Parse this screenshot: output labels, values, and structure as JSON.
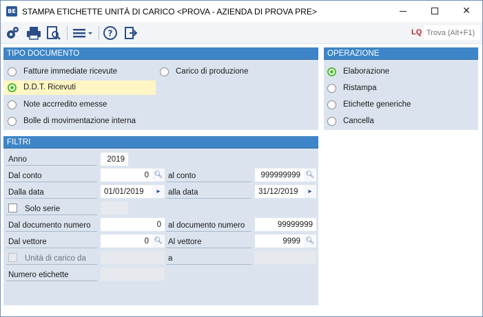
{
  "window": {
    "title": "STAMPA ETICHETTE UNITÀ DI CARICO <PROVA - AZIENDA DI PROVA PRE>",
    "app_icon": "BE"
  },
  "toolbar": {
    "search_prefix": "LQ",
    "search_placeholder": "Trova (Alt+F1)",
    "icons": [
      "settings-icon",
      "print-icon",
      "print-preview-icon",
      "menu-icon",
      "help-icon",
      "exit-icon"
    ]
  },
  "tipo_documento": {
    "header": "TIPO DOCUMENTO",
    "options": [
      {
        "label": "Fatture immediate ricevute",
        "selected": false
      },
      {
        "label": "Carico di produzione",
        "selected": false
      },
      {
        "label": "D.D.T. Ricevuti",
        "selected": true
      },
      {
        "label": "Note accrredito emesse",
        "selected": false
      },
      {
        "label": "Bolle di movimentazione interna",
        "selected": false
      }
    ]
  },
  "operazione": {
    "header": "OPERAZIONE",
    "options": [
      {
        "label": "Elaborazione",
        "selected": true
      },
      {
        "label": "Ristampa",
        "selected": false
      },
      {
        "label": "Etichette generiche",
        "selected": false
      },
      {
        "label": "Cancella",
        "selected": false
      }
    ]
  },
  "filtri": {
    "header": "FILTRI",
    "anno": {
      "label": "Anno",
      "value": "2019"
    },
    "dal_conto": {
      "label": "Dal conto",
      "value": "0"
    },
    "al_conto": {
      "label": "al conto",
      "value": "999999999"
    },
    "dalla_data": {
      "label": "Dalla data",
      "value": "01/01/2019"
    },
    "alla_data": {
      "label": "alla data",
      "value": "31/12/2019"
    },
    "solo_serie": {
      "label": "Solo serie",
      "value": ""
    },
    "dal_documento": {
      "label": "Dal documento numero",
      "value": "0"
    },
    "al_documento": {
      "label": "al documento numero",
      "value": "99999999"
    },
    "dal_vettore": {
      "label": "Dal vettore",
      "value": "0"
    },
    "al_vettore": {
      "label": "Al vettore",
      "value": "9999"
    },
    "unita_carico": {
      "label": "Unità di carico da",
      "value": ""
    },
    "a": {
      "label": "a",
      "value": ""
    },
    "numero_etichette": {
      "label": "Numero etichette",
      "value": ""
    }
  },
  "colors": {
    "header_blue": "#3d85c6",
    "panel_bg": "#dbe4ee",
    "radio_green": "#4cba2c",
    "selected_highlight": "#fff6c4",
    "search_accent": "#c0272d"
  }
}
